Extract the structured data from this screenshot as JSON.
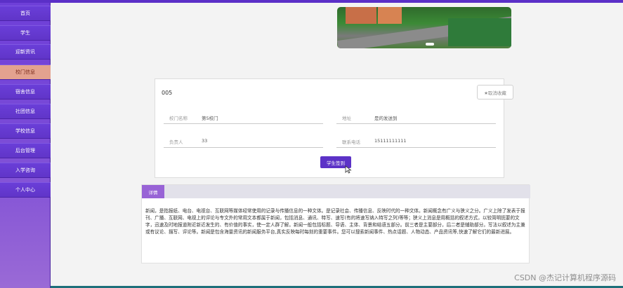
{
  "sidebar": {
    "items": [
      {
        "label": "首页"
      },
      {
        "label": "学生"
      },
      {
        "label": "迎新资讯"
      },
      {
        "label": "校门信息"
      },
      {
        "label": "宿舍信息"
      },
      {
        "label": "社团信息"
      },
      {
        "label": "学校信息"
      },
      {
        "label": "后台管理"
      },
      {
        "label": "入学咨询"
      },
      {
        "label": "个人中心"
      }
    ],
    "active_index": 3
  },
  "detail_card": {
    "code": "005",
    "favorite_button": "★取消收藏",
    "fields": {
      "gate_name_label": "校门名称",
      "gate_name_value": "第5校门",
      "address_label": "地址",
      "address_value": "是的发送到",
      "person_label": "负责人",
      "person_value": "33",
      "phone_label": "联系电话",
      "phone_value": "15111111111"
    },
    "checkin_button": "学生签到"
  },
  "details": {
    "tab_label": "详情",
    "text": "新闻，是指报纸、电台、电视台、互联网等媒体经常使用的记录与传播信息的一种文体。是记录社会、传播信息、反映时代的一种文体。新闻概念有广义与狭义之分。广义上除了发表于报刊、广播、互联网、电视上的评论与专文外的常用文本都属于新闻，包括消息、通讯、特写、速写(有的将速写纳入特写之列)等等；狭义上消息是用概括的叙述方式，以较简明扼要的文字，迅速及时地报道附近新近发生的、有价值的事实，使一定人群了解。新闻一般包括标题、导语、主体、背景和结语五部分。前三者是主要部分，后二者是辅助部分。写法以叙述为主兼或有议论、描写、评论等。新闻是包含海量资讯的新闻服务平台,真实反映每时每刻的重要事件。您可以搜索新闻事件、热点话题、人物动态、产品资讯等,快速了解它们的最新进展。"
  },
  "watermark": "CSDN @杰记计算机程序源码"
}
